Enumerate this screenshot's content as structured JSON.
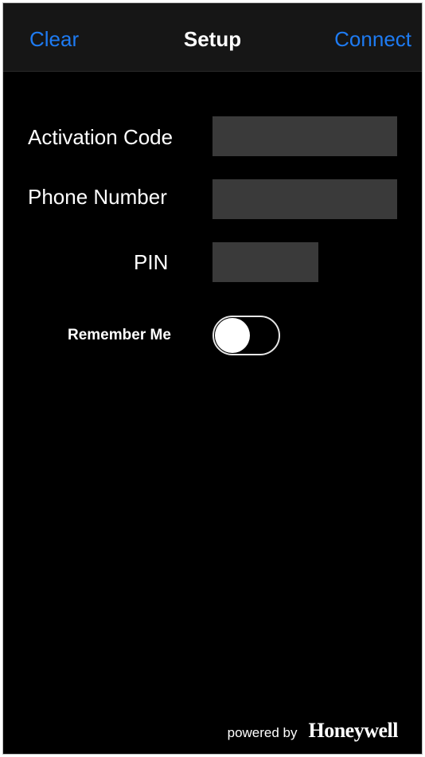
{
  "navbar": {
    "left_label": "Clear",
    "title": "Setup",
    "right_label": "Connect"
  },
  "form": {
    "activation_code": {
      "label": "Activation Code",
      "value": "",
      "placeholder": ""
    },
    "phone_number": {
      "label": "Phone Number",
      "value": "",
      "placeholder": ""
    },
    "pin": {
      "label": "PIN",
      "value": "",
      "placeholder": ""
    },
    "remember_me": {
      "label": "Remember Me",
      "on": false
    }
  },
  "footer": {
    "powered_by": "powered by",
    "brand": "Honeywell"
  },
  "colors": {
    "accent": "#1e7bf2",
    "background": "#000000",
    "field": "#3a3a3a"
  }
}
